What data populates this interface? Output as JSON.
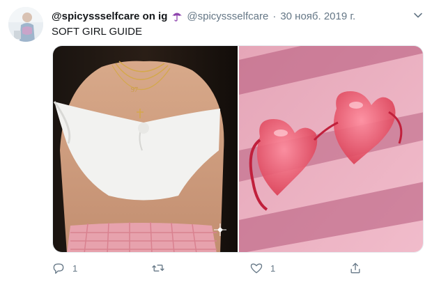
{
  "tweet": {
    "display_name": "@spicyssselfcare on ig",
    "handle": "@spicyssselfcare",
    "separator": "·",
    "date": "30 нояб. 2019 г.",
    "text": "SOFT GIRL GUIDE"
  },
  "icons": {
    "name_emoji": "umbrella-icon",
    "menu": "chevron-down-icon",
    "reply": "reply-icon",
    "retweet": "retweet-icon",
    "like": "heart-icon",
    "share": "share-icon"
  },
  "actions": {
    "reply_count": "1",
    "like_count": "1"
  },
  "colors": {
    "text_primary": "#14171a",
    "text_secondary": "#657786",
    "umbrella_purple": "#8e44ad"
  }
}
